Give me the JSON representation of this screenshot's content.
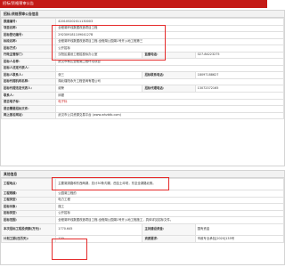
{
  "header": {
    "breadcrumb": "招标/资格预审公告"
  },
  "section1": {
    "title": "招标/资格预审公告信息",
    "rows": [
      {
        "label": "报建编号：",
        "value": "420105202011130003"
      },
      {
        "label": "项目名称：",
        "value": "全程湖环线数据改造项目工程"
      },
      {
        "label": "招标登记编号：",
        "value": "29230918110904127B"
      },
      {
        "label": "标段名称：",
        "value": "全程湖环线数据改造项目工程-全程湖公园湖1号开入地工程第三"
      },
      {
        "label": "招标方式：",
        "value": "公开招标"
      },
      {
        "label": "招标人名称：",
        "value": "武汉市和达全程湖工程环境项目"
      },
      {
        "label": "招标人法定代表人：",
        "value": ""
      },
      {
        "label": "招标人联系人：",
        "value": ""
      },
      {
        "label": "招标代理机构名称：",
        "value": "湖北瑾阳永升工程咨询有限公司"
      },
      {
        "label": "招标代理法定代表人：",
        "value": ""
      },
      {
        "label": "是否电子标：",
        "value": "电子标"
      },
      {
        "label": "是否需要招标文件：",
        "value": ""
      },
      {
        "label": "网上报名网站：",
        "value": "武汉市公共资源交易平台 (www.whzbtb.com)"
      }
    ],
    "side": {
      "fields": [
        {
          "label": "行政主管部门：",
          "value": "汉阳区建设工程招投标办公室"
        },
        {
          "label": "招标人联系人：",
          "value": "张三"
        },
        {
          "label": "招标代理联系人：",
          "value": "谢荣"
        },
        {
          "label": "联系人：",
          "value": "邱健"
        }
      ],
      "phones": [
        {
          "label": "监督电话：",
          "value": "027-84223275"
        },
        {
          "label": "招标联系电话：",
          "value": "18097188627"
        },
        {
          "label": "招标代理电话：",
          "value": "13072372165"
        }
      ]
    }
  },
  "section2": {
    "title": "其他信息",
    "rows": [
      {
        "label": "工程地点：",
        "value": "主要湖滨路和东西两湖，总计30条沟渠，西至土坪坝，东至全湖路北侧。"
      },
      {
        "label": "工程规模：",
        "value": "公园湖工程的"
      },
      {
        "label": "工程类型：",
        "value": "电力工程"
      },
      {
        "label": "招标对象：",
        "value": "施工"
      },
      {
        "label": "招标类型：",
        "value": "公开招标"
      },
      {
        "label": "招标范围：",
        "value": "全程湖环线数据改造项目工程-全程湖公园湖1号开入地工程施工，具体详见招标文件。"
      },
      {
        "label": "本次招标工程投资额(万元)：",
        "value": "1770.645"
      },
      {
        "label": "计划工期(日历天)：",
        "value": "120"
      }
    ],
    "extra": [
      {
        "label": "主持建设资金：",
        "value": "国有资金"
      },
      {
        "label": "资质要求：",
        "value": "市政专业承包[2020]135号"
      }
    ]
  }
}
